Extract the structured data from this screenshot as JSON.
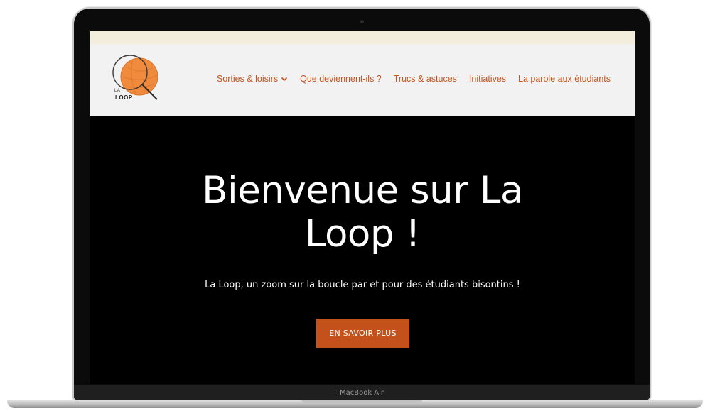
{
  "device": {
    "label": "MacBook Air"
  },
  "site": {
    "logo": {
      "text_top": "LA",
      "text_bottom": "LOOP"
    },
    "nav": [
      {
        "label": "Sorties & loisirs",
        "has_dropdown": true
      },
      {
        "label": "Que deviennent-ils ?"
      },
      {
        "label": "Trucs & astuces"
      },
      {
        "label": "Initiatives"
      },
      {
        "label": "La parole aux étudiants"
      }
    ]
  },
  "hero": {
    "title_line1": "Bienvenue sur La",
    "title_line2": "Loop !",
    "subtitle": "La Loop, un zoom sur la boucle par et pour des étudiants bisontins !",
    "cta_label": "EN SAVOIR PLUS"
  },
  "colors": {
    "accent": "#c4511b",
    "header_bg": "#f2f2f2",
    "hero_bg": "#000000",
    "logo_orange": "#f08a3c"
  },
  "icons": {
    "logo_mark": "magnifying-glass-orange-ball",
    "nav_dropdown": "chevron-down-icon"
  }
}
